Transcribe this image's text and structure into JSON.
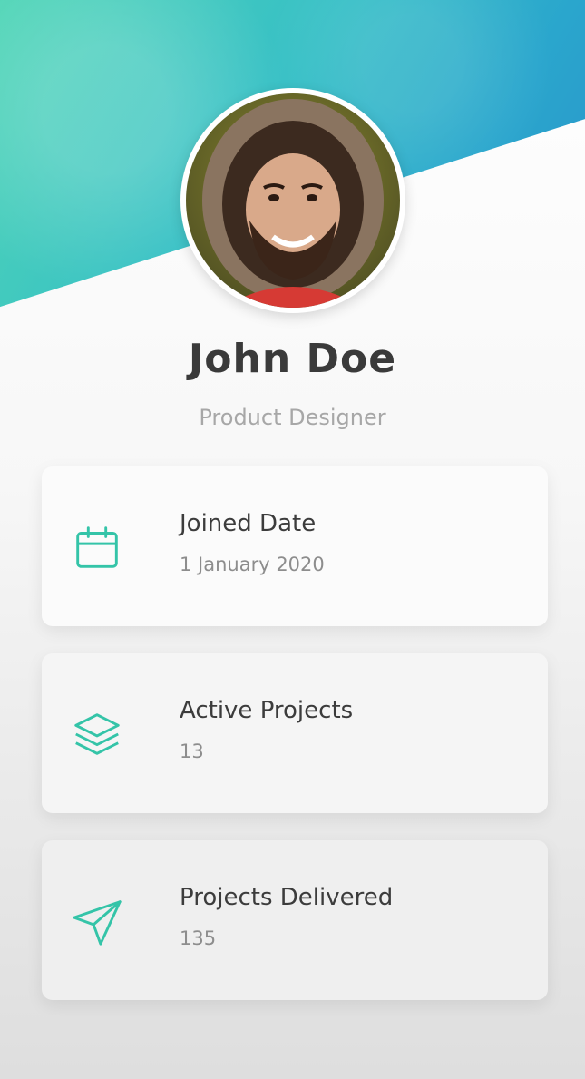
{
  "profile": {
    "name": "John Doe",
    "role": "Product Designer"
  },
  "stats": [
    {
      "label": "Joined Date",
      "value": "1 January 2020",
      "icon": "calendar-icon"
    },
    {
      "label": "Active Projects",
      "value": "13",
      "icon": "layers-icon"
    },
    {
      "label": "Projects Delivered",
      "value": "135",
      "icon": "paper-plane-icon"
    }
  ],
  "colors": {
    "accent": "#34c4a8",
    "header_gradient_start": "#4fd5b6",
    "header_gradient_end": "#2a93c9",
    "name_text": "#3a3a3a",
    "muted_text": "#a7a7a7"
  }
}
